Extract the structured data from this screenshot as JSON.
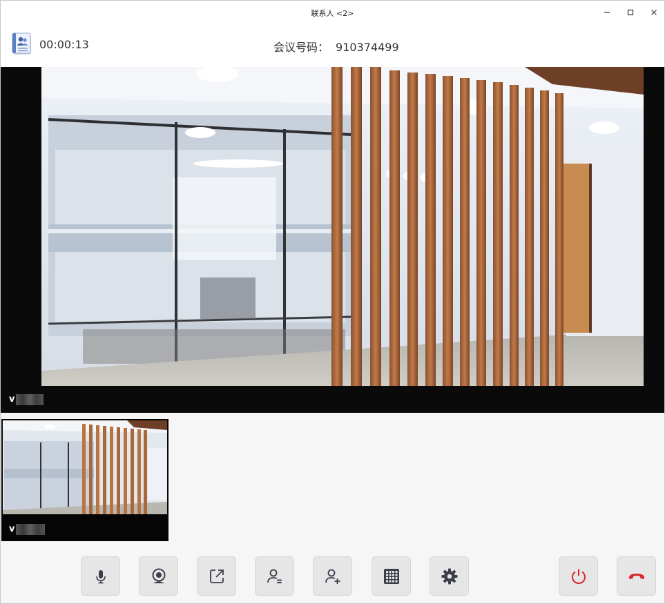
{
  "window": {
    "title": "联系人 <2>"
  },
  "header": {
    "timer": "00:00:13",
    "meeting_label": "会议号码：",
    "meeting_number": "910374499"
  },
  "main_video": {
    "participant_initial": "v"
  },
  "thumbnail": {
    "participant_initial": "v"
  },
  "toolbar": {
    "buttons": [
      {
        "name": "microphone",
        "icon": "microphone-icon"
      },
      {
        "name": "camera",
        "icon": "webcam-icon"
      },
      {
        "name": "share",
        "icon": "share-icon"
      },
      {
        "name": "participants",
        "icon": "user-list-icon"
      },
      {
        "name": "invite",
        "icon": "user-add-icon"
      },
      {
        "name": "layout",
        "icon": "grid-icon"
      },
      {
        "name": "settings",
        "icon": "gear-icon"
      },
      {
        "name": "end-meeting",
        "icon": "power-icon"
      },
      {
        "name": "hang-up",
        "icon": "phone-hangup-icon"
      }
    ]
  },
  "colors": {
    "icon": "#3a3f4b",
    "danger": "#d9262c",
    "toolbar_button": "#e6e6e6"
  }
}
